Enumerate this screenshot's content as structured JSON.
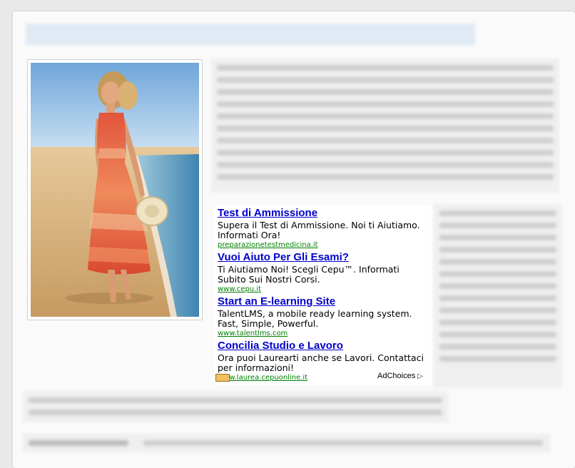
{
  "ads": {
    "items": [
      {
        "title": "Test di Ammissione",
        "description": "Supera il Test di Ammissione. Noi ti Aiutiamo. Informati Ora!",
        "url": "preparazionetestmedicina.it"
      },
      {
        "title": "Vuoi Aiuto Per Gli Esami?",
        "description": "Ti Aiutiamo Noi! Scegli Cepu™. Informati Subito Sui Nostri Corsi.",
        "url": "www.cepu.it"
      },
      {
        "title": "Start an E-learning Site",
        "description": "TalentLMS, a mobile ready learning system. Fast, Simple, Powerful.",
        "url": "www.talentlms.com"
      },
      {
        "title": "Concilia Studio e Lavoro",
        "description": "Ora puoi Laurearti anche se Lavori. Contattaci per informazioni!",
        "url": "www.laurea.cepuonline.it"
      }
    ],
    "adchoices_label": "AdChoices",
    "adchoices_icon": "adchoices-triangle-icon"
  },
  "colors": {
    "ad_title": "#0000cc",
    "ad_url": "#008000",
    "heading_blur": "#7aa7d2"
  }
}
